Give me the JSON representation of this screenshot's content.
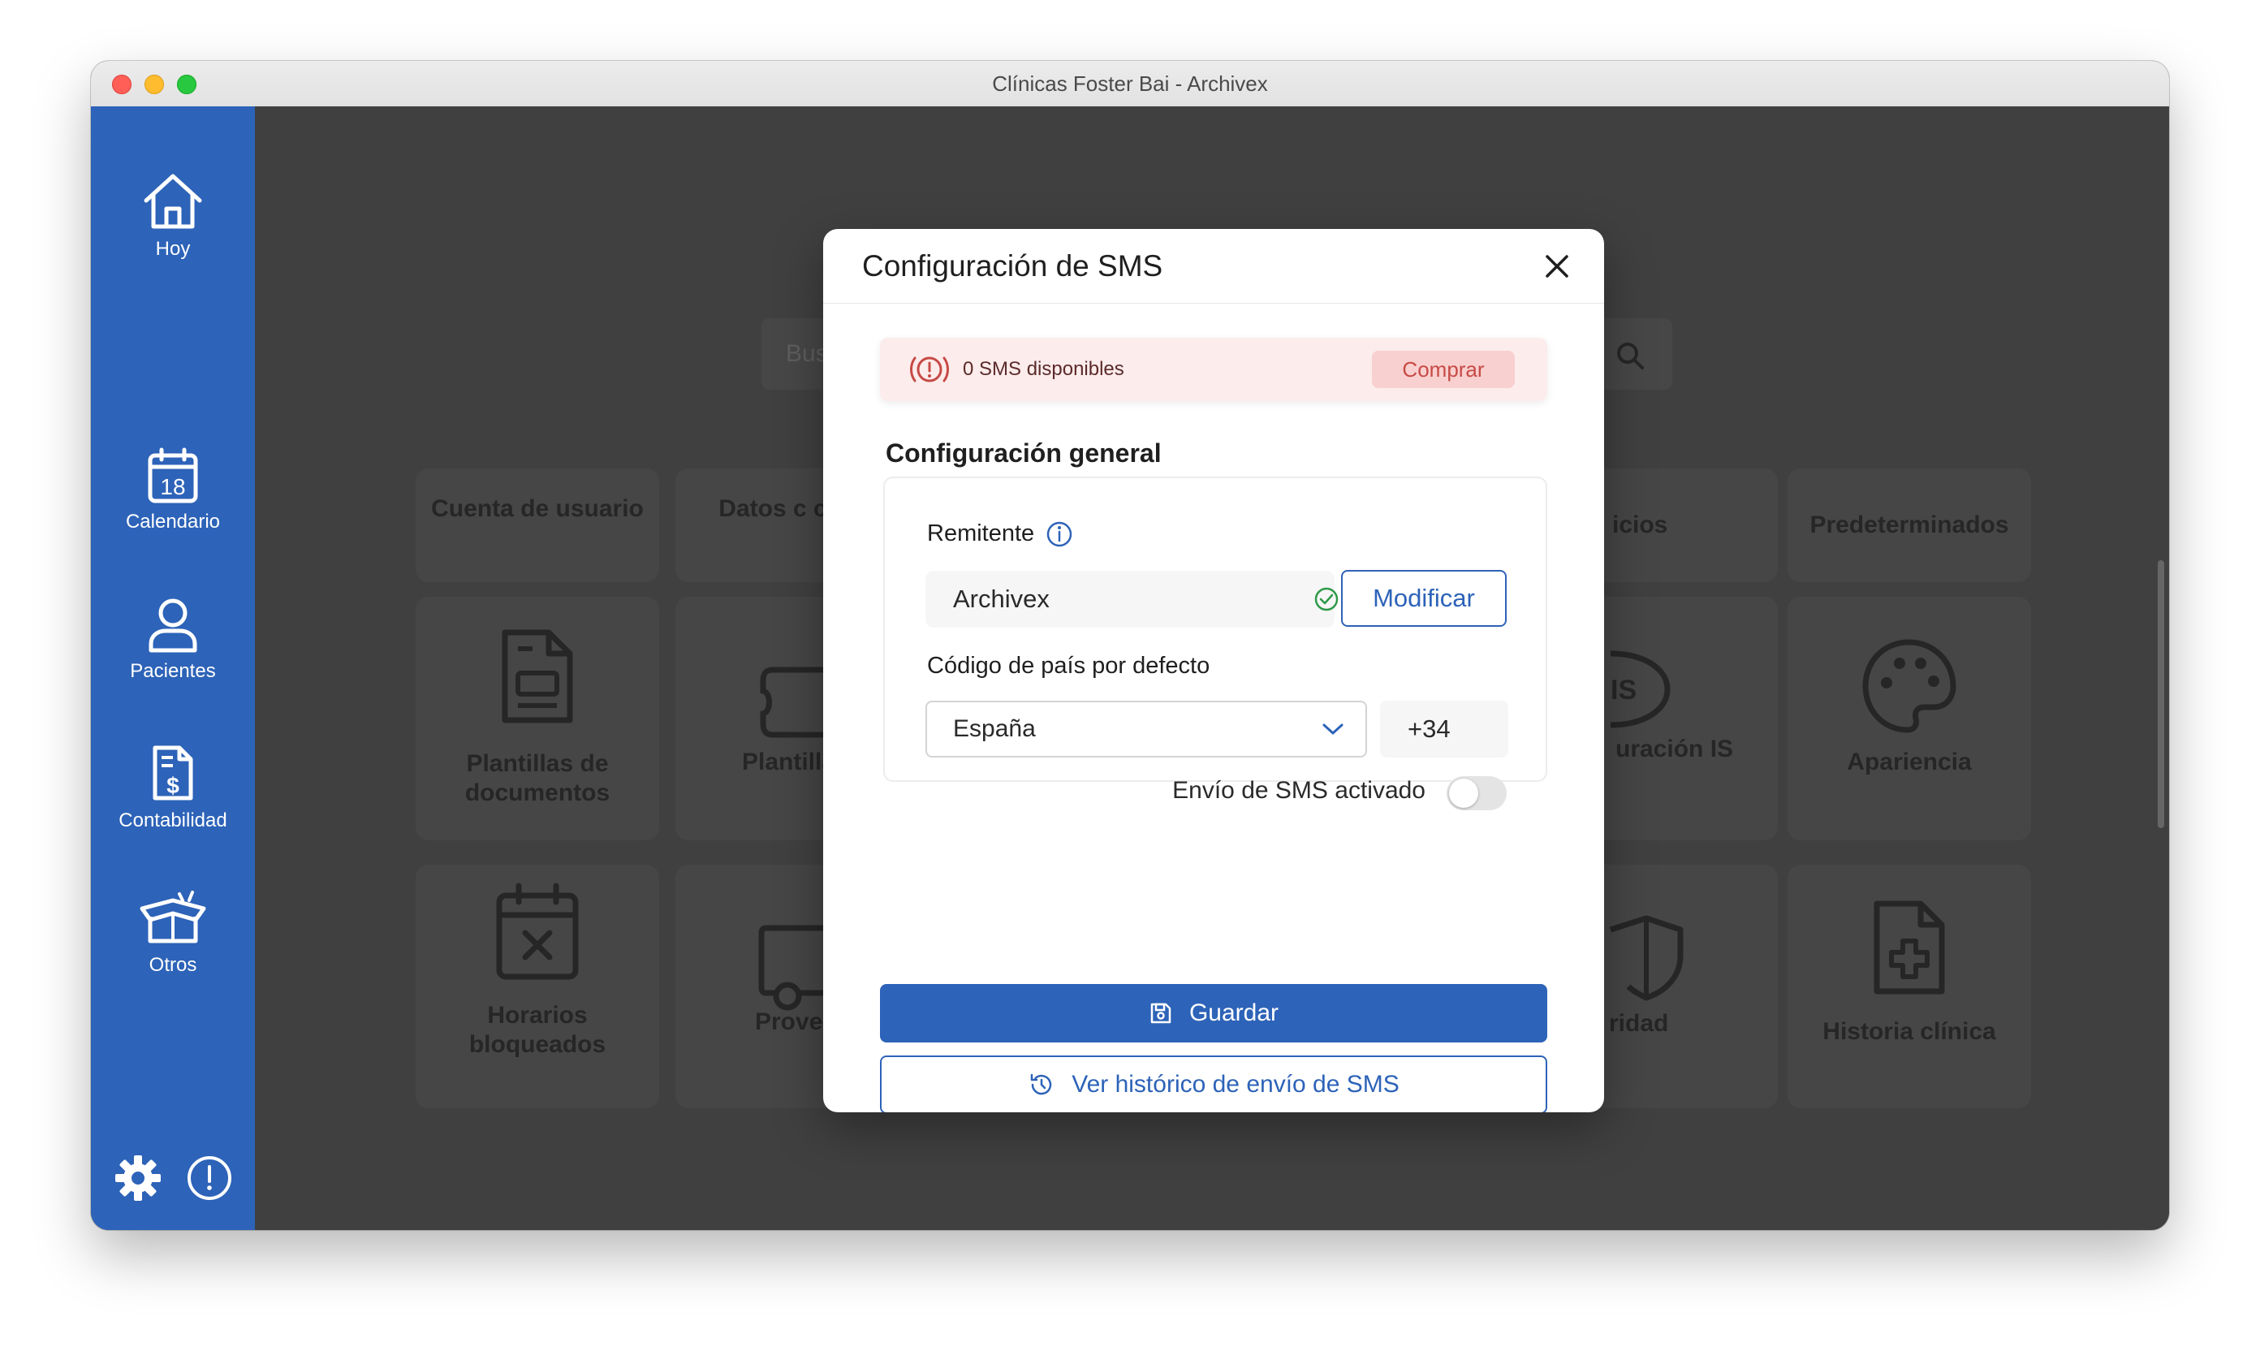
{
  "window": {
    "title": "Clínicas Foster Bai - Archivex"
  },
  "sidebar": {
    "items": [
      {
        "label": "Hoy",
        "icon": "home-icon"
      },
      {
        "label": "Calendario",
        "icon": "calendar-icon",
        "badge": "18"
      },
      {
        "label": "Pacientes",
        "icon": "user-icon"
      },
      {
        "label": "Contabilidad",
        "icon": "invoice-icon"
      },
      {
        "label": "Otros",
        "icon": "box-icon"
      }
    ],
    "bottom_icons": [
      "gear-icon",
      "alert-icon"
    ]
  },
  "background": {
    "search_placeholder": "Bus",
    "tiles": [
      {
        "label": "Cuenta de usuario"
      },
      {
        "label": "Datos c clínic"
      },
      {
        "label": "icios"
      },
      {
        "label": "Predeterminados"
      },
      {
        "label": "Plantillas de documentos"
      },
      {
        "label": "Plantillas c"
      },
      {
        "label": "uración IS"
      },
      {
        "label": "Apariencia"
      },
      {
        "label": "Horarios bloqueados"
      },
      {
        "label": "Proveed"
      },
      {
        "label": "ridad"
      },
      {
        "label": "Historia clínica"
      }
    ]
  },
  "modal": {
    "title": "Configuración de SMS",
    "alert": {
      "text": "0 SMS disponibles",
      "button": "Comprar"
    },
    "section_title": "Configuración general",
    "sender_label": "Remitente",
    "sender_value": "Archivex",
    "modify_button": "Modificar",
    "country_label": "Código de país por defecto",
    "country_value": "España",
    "country_code": "+34",
    "toggle_label": "Envío de SMS activado",
    "toggle_on": false,
    "save_button": "Guardar",
    "history_button": "Ver histórico de envío de SMS"
  },
  "colors": {
    "sidebar": "#2d63b8",
    "primary": "#2d63b8",
    "alert_bg": "#fcecec",
    "alert_button": "#c74a45"
  }
}
